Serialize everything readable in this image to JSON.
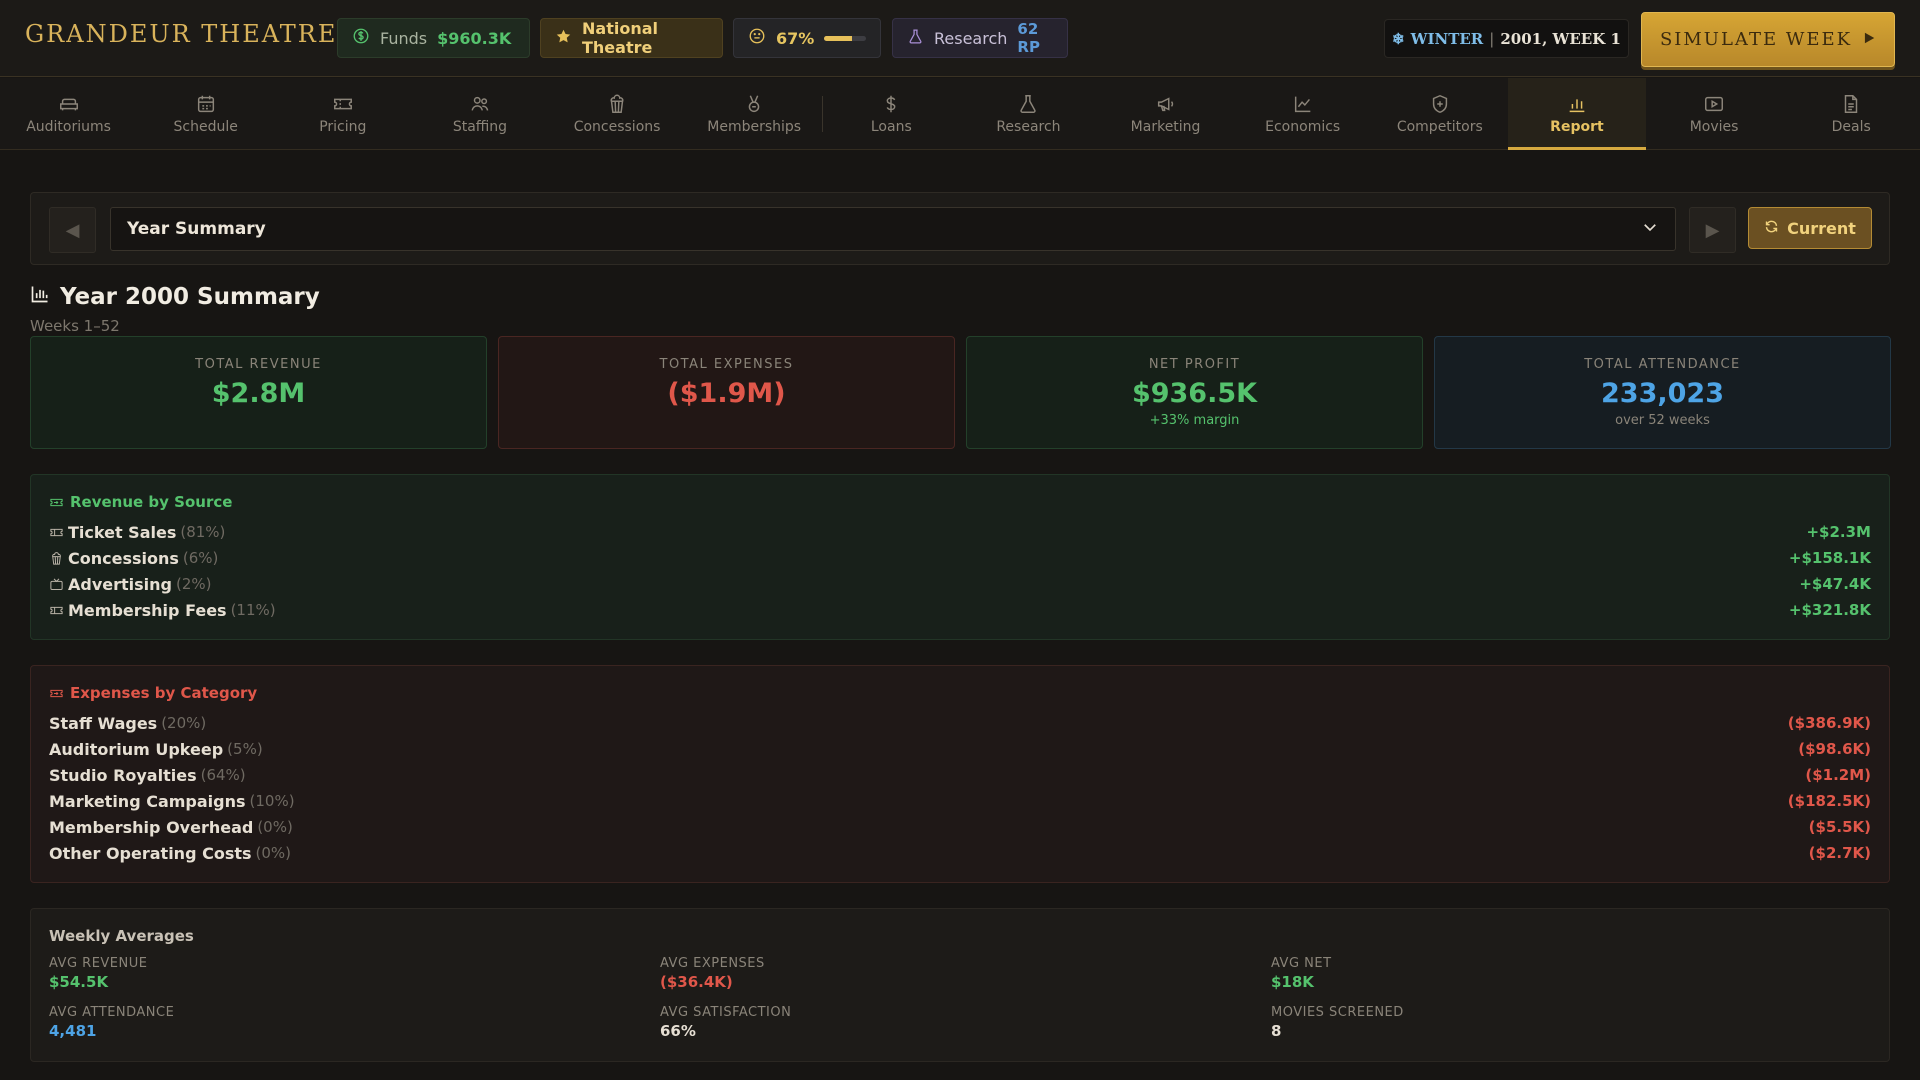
{
  "app": {
    "title": "GRANDEUR THEATRE"
  },
  "topbar": {
    "funds_label": "Funds",
    "funds_value": "$960.3K",
    "reputation": "National Theatre",
    "satisfaction": "67%",
    "satisfaction_fraction": 0.67,
    "research_label": "Research",
    "research_value": "62 RP",
    "season": "WINTER",
    "season_sep": "|",
    "year_week": "2001, WEEK 1",
    "simulate_label": "SIMULATE WEEK"
  },
  "nav": {
    "items": [
      {
        "label": "Auditoriums",
        "icon": "sofa-icon"
      },
      {
        "label": "Schedule",
        "icon": "calendar-icon"
      },
      {
        "label": "Pricing",
        "icon": "ticket-icon"
      },
      {
        "label": "Staffing",
        "icon": "people-icon"
      },
      {
        "label": "Concessions",
        "icon": "popcorn-icon"
      },
      {
        "label": "Memberships",
        "icon": "medal-icon"
      },
      {
        "label": "Loans",
        "icon": "dollar-icon"
      },
      {
        "label": "Research",
        "icon": "flask-icon"
      },
      {
        "label": "Marketing",
        "icon": "megaphone-icon"
      },
      {
        "label": "Economics",
        "icon": "chart-line-icon"
      },
      {
        "label": "Competitors",
        "icon": "shield-icon"
      },
      {
        "label": "Report",
        "icon": "bar-chart-icon"
      },
      {
        "label": "Movies",
        "icon": "play-icon"
      },
      {
        "label": "Deals",
        "icon": "document-icon"
      }
    ],
    "active": "Report"
  },
  "period": {
    "selected": "Year Summary",
    "current_label": "Current"
  },
  "summary": {
    "title": "Year 2000 Summary",
    "subtitle": "Weeks 1–52"
  },
  "kpis": {
    "revenue": {
      "label": "TOTAL REVENUE",
      "value": "$2.8M"
    },
    "expenses": {
      "label": "TOTAL EXPENSES",
      "value": "($1.9M)"
    },
    "net": {
      "label": "NET PROFIT",
      "value": "$936.5K",
      "note": "+33% margin"
    },
    "attendance": {
      "label": "TOTAL ATTENDANCE",
      "value": "233,023",
      "note": "over 52 weeks"
    }
  },
  "revenue_by_source": {
    "title": "Revenue by Source",
    "rows": [
      {
        "name": "Ticket Sales",
        "pct": "(81%)",
        "amount": "+$2.3M",
        "icon": "ticket-icon"
      },
      {
        "name": "Concessions",
        "pct": "(6%)",
        "amount": "+$158.1K",
        "icon": "popcorn-icon"
      },
      {
        "name": "Advertising",
        "pct": "(2%)",
        "amount": "+$47.4K",
        "icon": "tv-icon"
      },
      {
        "name": "Membership Fees",
        "pct": "(11%)",
        "amount": "+$321.8K",
        "icon": "ticket-icon"
      }
    ]
  },
  "expenses_by_category": {
    "title": "Expenses by Category",
    "rows": [
      {
        "name": "Staff Wages",
        "pct": "(20%)",
        "amount": "($386.9K)"
      },
      {
        "name": "Auditorium Upkeep",
        "pct": "(5%)",
        "amount": "($98.6K)"
      },
      {
        "name": "Studio Royalties",
        "pct": "(64%)",
        "amount": "($1.2M)"
      },
      {
        "name": "Marketing Campaigns",
        "pct": "(10%)",
        "amount": "($182.5K)"
      },
      {
        "name": "Membership Overhead",
        "pct": "(0%)",
        "amount": "($5.5K)"
      },
      {
        "name": "Other Operating Costs",
        "pct": "(0%)",
        "amount": "($2.7K)"
      }
    ]
  },
  "weekly_averages": {
    "title": "Weekly Averages",
    "avg_revenue": {
      "label": "AVG REVENUE",
      "value": "$54.5K"
    },
    "avg_expenses": {
      "label": "AVG EXPENSES",
      "value": "($36.4K)"
    },
    "avg_net": {
      "label": "AVG NET",
      "value": "$18K"
    },
    "avg_attendance": {
      "label": "AVG ATTENDANCE",
      "value": "4,481"
    },
    "avg_satisfaction": {
      "label": "AVG SATISFACTION",
      "value": "66%"
    },
    "movies_screened": {
      "label": "MOVIES SCREENED",
      "value": "8"
    }
  },
  "colors": {
    "gold": "#d6aa40",
    "positive": "#55c26d",
    "negative": "#e0574a",
    "info": "#4ea4e6"
  }
}
